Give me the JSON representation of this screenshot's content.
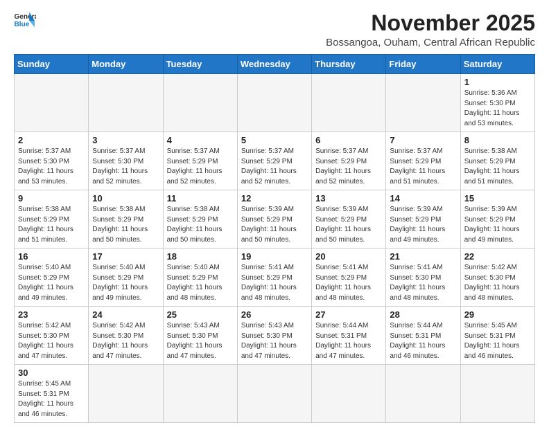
{
  "header": {
    "logo_line1": "General",
    "logo_line2": "Blue",
    "title": "November 2025",
    "subtitle": "Bossangoa, Ouham, Central African Republic"
  },
  "weekdays": [
    "Sunday",
    "Monday",
    "Tuesday",
    "Wednesday",
    "Thursday",
    "Friday",
    "Saturday"
  ],
  "weeks": [
    [
      {
        "day": "",
        "info": ""
      },
      {
        "day": "",
        "info": ""
      },
      {
        "day": "",
        "info": ""
      },
      {
        "day": "",
        "info": ""
      },
      {
        "day": "",
        "info": ""
      },
      {
        "day": "",
        "info": ""
      },
      {
        "day": "1",
        "info": "Sunrise: 5:36 AM\nSunset: 5:30 PM\nDaylight: 11 hours\nand 53 minutes."
      }
    ],
    [
      {
        "day": "2",
        "info": "Sunrise: 5:37 AM\nSunset: 5:30 PM\nDaylight: 11 hours\nand 53 minutes."
      },
      {
        "day": "3",
        "info": "Sunrise: 5:37 AM\nSunset: 5:30 PM\nDaylight: 11 hours\nand 52 minutes."
      },
      {
        "day": "4",
        "info": "Sunrise: 5:37 AM\nSunset: 5:29 PM\nDaylight: 11 hours\nand 52 minutes."
      },
      {
        "day": "5",
        "info": "Sunrise: 5:37 AM\nSunset: 5:29 PM\nDaylight: 11 hours\nand 52 minutes."
      },
      {
        "day": "6",
        "info": "Sunrise: 5:37 AM\nSunset: 5:29 PM\nDaylight: 11 hours\nand 52 minutes."
      },
      {
        "day": "7",
        "info": "Sunrise: 5:37 AM\nSunset: 5:29 PM\nDaylight: 11 hours\nand 51 minutes."
      },
      {
        "day": "8",
        "info": "Sunrise: 5:38 AM\nSunset: 5:29 PM\nDaylight: 11 hours\nand 51 minutes."
      }
    ],
    [
      {
        "day": "9",
        "info": "Sunrise: 5:38 AM\nSunset: 5:29 PM\nDaylight: 11 hours\nand 51 minutes."
      },
      {
        "day": "10",
        "info": "Sunrise: 5:38 AM\nSunset: 5:29 PM\nDaylight: 11 hours\nand 50 minutes."
      },
      {
        "day": "11",
        "info": "Sunrise: 5:38 AM\nSunset: 5:29 PM\nDaylight: 11 hours\nand 50 minutes."
      },
      {
        "day": "12",
        "info": "Sunrise: 5:39 AM\nSunset: 5:29 PM\nDaylight: 11 hours\nand 50 minutes."
      },
      {
        "day": "13",
        "info": "Sunrise: 5:39 AM\nSunset: 5:29 PM\nDaylight: 11 hours\nand 50 minutes."
      },
      {
        "day": "14",
        "info": "Sunrise: 5:39 AM\nSunset: 5:29 PM\nDaylight: 11 hours\nand 49 minutes."
      },
      {
        "day": "15",
        "info": "Sunrise: 5:39 AM\nSunset: 5:29 PM\nDaylight: 11 hours\nand 49 minutes."
      }
    ],
    [
      {
        "day": "16",
        "info": "Sunrise: 5:40 AM\nSunset: 5:29 PM\nDaylight: 11 hours\nand 49 minutes."
      },
      {
        "day": "17",
        "info": "Sunrise: 5:40 AM\nSunset: 5:29 PM\nDaylight: 11 hours\nand 49 minutes."
      },
      {
        "day": "18",
        "info": "Sunrise: 5:40 AM\nSunset: 5:29 PM\nDaylight: 11 hours\nand 48 minutes."
      },
      {
        "day": "19",
        "info": "Sunrise: 5:41 AM\nSunset: 5:29 PM\nDaylight: 11 hours\nand 48 minutes."
      },
      {
        "day": "20",
        "info": "Sunrise: 5:41 AM\nSunset: 5:29 PM\nDaylight: 11 hours\nand 48 minutes."
      },
      {
        "day": "21",
        "info": "Sunrise: 5:41 AM\nSunset: 5:30 PM\nDaylight: 11 hours\nand 48 minutes."
      },
      {
        "day": "22",
        "info": "Sunrise: 5:42 AM\nSunset: 5:30 PM\nDaylight: 11 hours\nand 48 minutes."
      }
    ],
    [
      {
        "day": "23",
        "info": "Sunrise: 5:42 AM\nSunset: 5:30 PM\nDaylight: 11 hours\nand 47 minutes."
      },
      {
        "day": "24",
        "info": "Sunrise: 5:42 AM\nSunset: 5:30 PM\nDaylight: 11 hours\nand 47 minutes."
      },
      {
        "day": "25",
        "info": "Sunrise: 5:43 AM\nSunset: 5:30 PM\nDaylight: 11 hours\nand 47 minutes."
      },
      {
        "day": "26",
        "info": "Sunrise: 5:43 AM\nSunset: 5:30 PM\nDaylight: 11 hours\nand 47 minutes."
      },
      {
        "day": "27",
        "info": "Sunrise: 5:44 AM\nSunset: 5:31 PM\nDaylight: 11 hours\nand 47 minutes."
      },
      {
        "day": "28",
        "info": "Sunrise: 5:44 AM\nSunset: 5:31 PM\nDaylight: 11 hours\nand 46 minutes."
      },
      {
        "day": "29",
        "info": "Sunrise: 5:45 AM\nSunset: 5:31 PM\nDaylight: 11 hours\nand 46 minutes."
      }
    ],
    [
      {
        "day": "30",
        "info": "Sunrise: 5:45 AM\nSunset: 5:31 PM\nDaylight: 11 hours\nand 46 minutes."
      },
      {
        "day": "",
        "info": ""
      },
      {
        "day": "",
        "info": ""
      },
      {
        "day": "",
        "info": ""
      },
      {
        "day": "",
        "info": ""
      },
      {
        "day": "",
        "info": ""
      },
      {
        "day": "",
        "info": ""
      }
    ]
  ]
}
